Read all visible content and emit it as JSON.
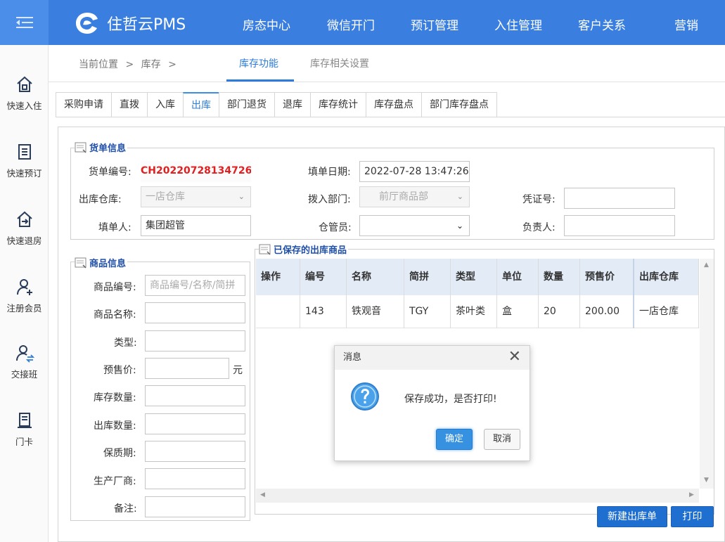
{
  "colors": {
    "topbar": "#3a7fe0",
    "accent": "#2d7cd9",
    "order_no": "#e02020",
    "primary_button": "#1e6fd0"
  },
  "brand": {
    "name": "住哲云PMS",
    "logo_icon": "brand-logo-icon"
  },
  "top_nav": [
    "房态中心",
    "微信开门",
    "预订管理",
    "入住管理",
    "客户关系",
    "营销"
  ],
  "sidebar": {
    "items": [
      {
        "label": "快速入住",
        "icon": "home-icon"
      },
      {
        "label": "快速预订",
        "icon": "document-icon"
      },
      {
        "label": "快速退房",
        "icon": "checkout-icon"
      },
      {
        "label": "注册会员",
        "icon": "add-user-icon"
      },
      {
        "label": "交接班",
        "icon": "shift-handover-icon"
      },
      {
        "label": "门卡",
        "icon": "card-icon"
      }
    ]
  },
  "breadcrumb": {
    "prefix": "当前位置",
    "sep1": ">",
    "section": "库存",
    "sep2": ">"
  },
  "func_tabs": {
    "active": "库存功能",
    "other": "库存相关设置"
  },
  "sub_tabs": [
    "采购申请",
    "直拨",
    "入库",
    "出库",
    "部门退货",
    "退库",
    "库存统计",
    "库存盘点",
    "部门库存盘点"
  ],
  "order_info": {
    "legend": "货单信息",
    "order_no_label": "货单编号:",
    "order_no": "CH20220728134726",
    "date_label": "填单日期:",
    "date": "2022-07-28 13:47:26",
    "warehouse_label": "出库仓库:",
    "warehouse": "一店仓库",
    "dept_label": "拨入部门:",
    "dept": "前厅商品部",
    "voucher_label": "凭证号:",
    "voucher": "",
    "filler_label": "填单人:",
    "filler": "集团超管",
    "keeper_label": "仓管员:",
    "keeper": "",
    "owner_label": "负责人:",
    "owner": ""
  },
  "product_info": {
    "legend": "商品信息",
    "code_label": "商品编号:",
    "code_placeholder": "商品编号/名称/简拼",
    "name_label": "商品名称:",
    "type_label": "类型:",
    "price_label": "预售价:",
    "price_unit": "元",
    "stock_label": "库存数量:",
    "out_qty_label": "出库数量:",
    "shelf_label": "保质期:",
    "maker_label": "生产厂商:",
    "note_label": "备注:"
  },
  "saved_items": {
    "legend": "已保存的出库商品",
    "columns": [
      "操作",
      "编号",
      "名称",
      "简拼",
      "类型",
      "单位",
      "数量",
      "预售价",
      "出库仓库"
    ],
    "rows": [
      [
        "",
        "143",
        "铁观音",
        "TGY",
        "茶叶类",
        "盒",
        "20",
        "200.00",
        "一店仓库"
      ]
    ]
  },
  "buttons": {
    "new_out_order": "新建出库单",
    "print": "打印"
  },
  "dialog": {
    "title": "消息",
    "close_icon": "close-icon",
    "message": "保存成功，是否打印!",
    "icon": "question-icon",
    "ok": "确定",
    "cancel": "取消"
  }
}
